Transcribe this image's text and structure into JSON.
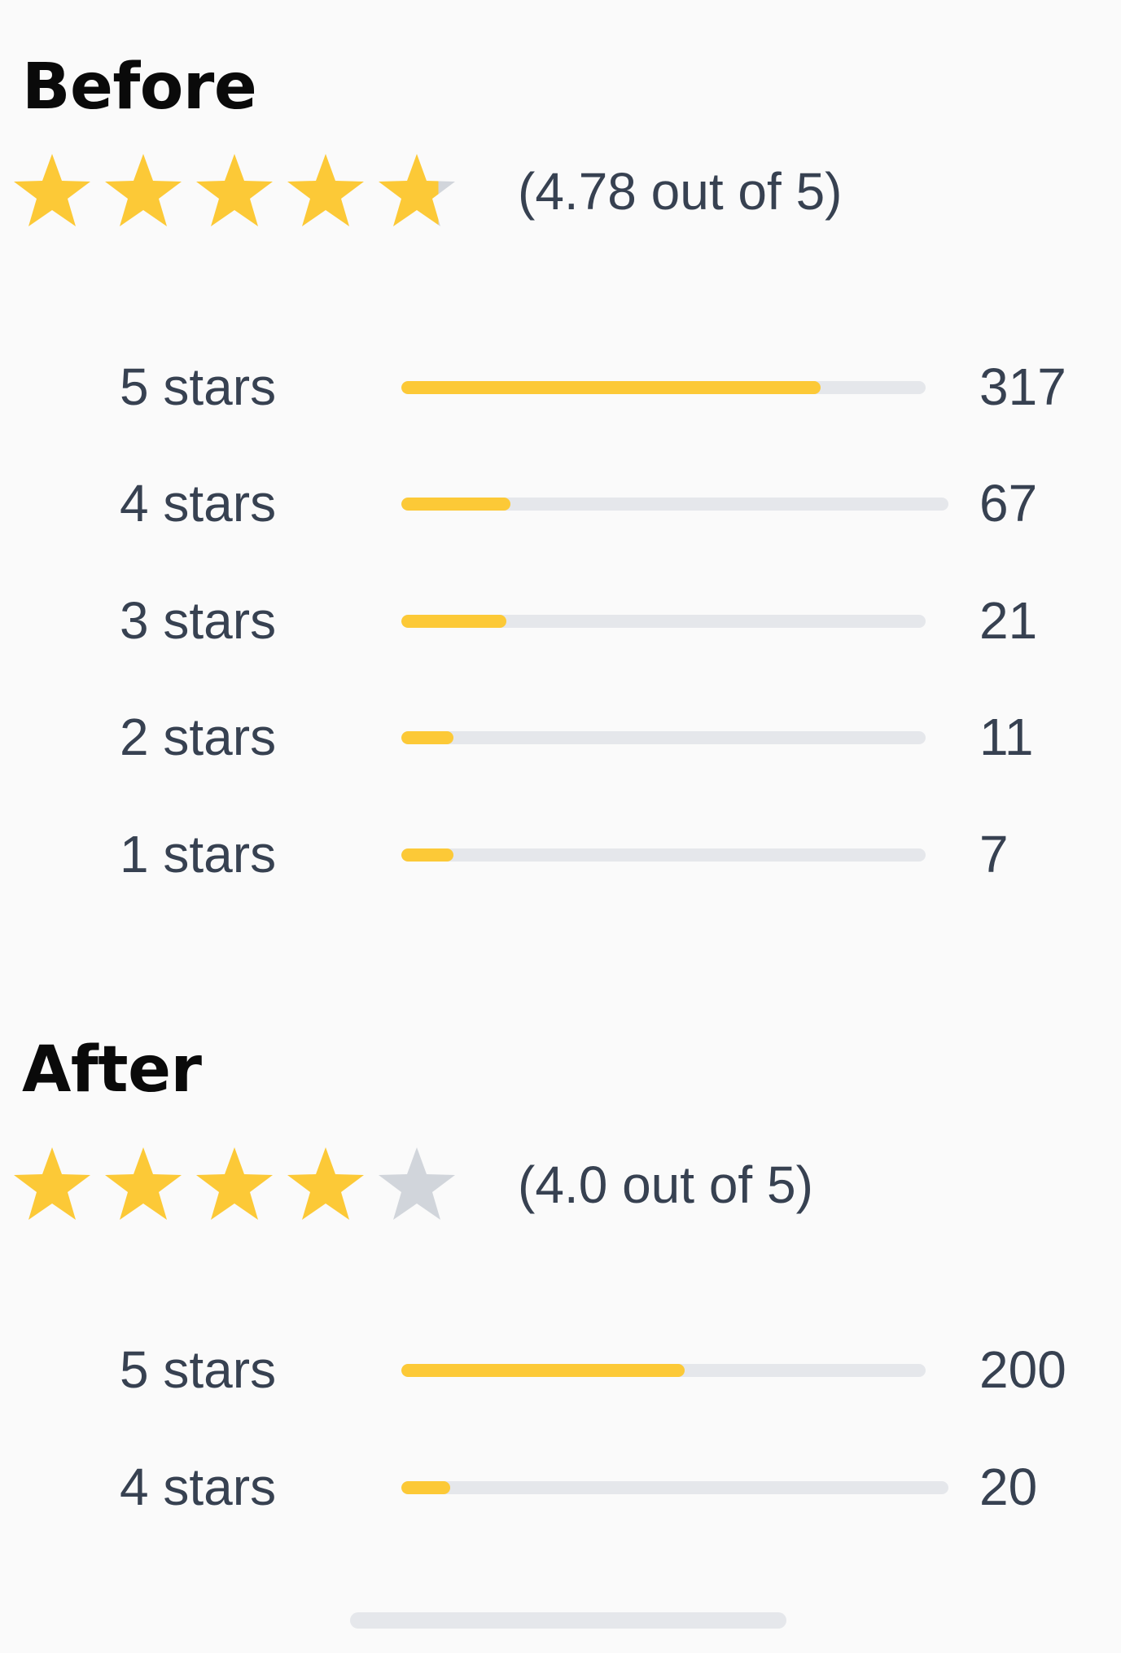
{
  "colors": {
    "star_filled": "#fcc937",
    "star_empty": "#d1d5db",
    "bar_track": "#e5e7eb",
    "bar_fill": "#fcc937",
    "text": "#374151",
    "title": "#0a0a0a"
  },
  "sections": [
    {
      "title": "Before",
      "rating": 4.78,
      "star_icons": [
        "star-filled-icon",
        "star-filled-icon",
        "star-filled-icon",
        "star-filled-icon",
        "star-partial-icon"
      ],
      "star_fill_fractions": [
        1,
        1,
        1,
        1,
        0.78
      ],
      "rating_text": "(4.78 out of 5)",
      "distribution": [
        {
          "label": "5 stars",
          "count": "317",
          "fill_fraction": 0.8
        },
        {
          "label": "4 stars",
          "count": "67",
          "fill_fraction": 0.2
        },
        {
          "label": "3 stars",
          "count": "21",
          "fill_fraction": 0.2
        },
        {
          "label": "2 stars",
          "count": "11",
          "fill_fraction": 0.1
        },
        {
          "label": "1 stars",
          "count": "7",
          "fill_fraction": 0.1
        }
      ]
    },
    {
      "title": "After",
      "rating": 4.0,
      "star_icons": [
        "star-filled-icon",
        "star-filled-icon",
        "star-filled-icon",
        "star-filled-icon",
        "star-empty-icon"
      ],
      "star_fill_fractions": [
        1,
        1,
        1,
        1,
        0
      ],
      "rating_text": "(4.0 out of 5)",
      "distribution": [
        {
          "label": "5 stars",
          "count": "200",
          "fill_fraction": 0.54
        },
        {
          "label": "4 stars",
          "count": "20",
          "fill_fraction": 0.09
        }
      ]
    }
  ]
}
